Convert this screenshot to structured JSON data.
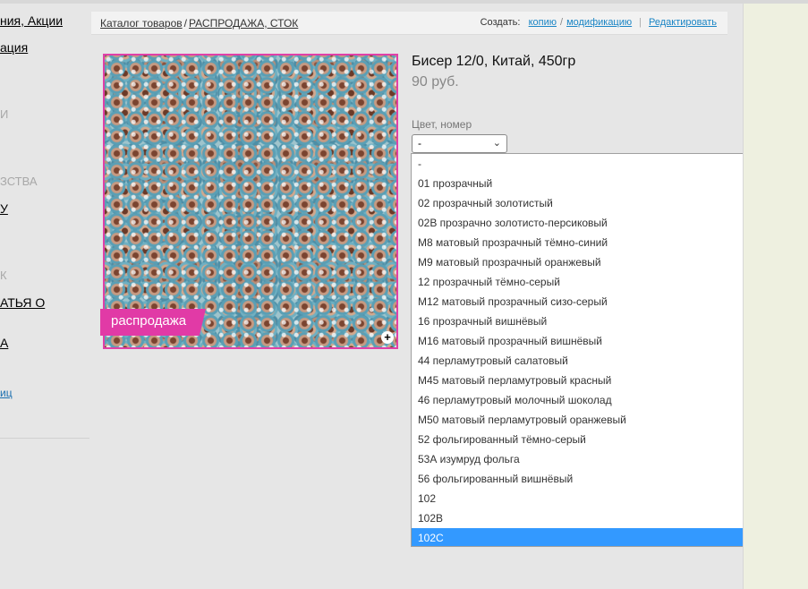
{
  "sidebar": {
    "items": [
      {
        "label": "ния, Акции",
        "style": "link"
      },
      {
        "label": "ация",
        "style": "link"
      },
      {
        "label": "И",
        "style": "grey"
      },
      {
        "label": "ЗСТВА",
        "style": "grey"
      },
      {
        "label": "У",
        "style": "link"
      },
      {
        "label": "К",
        "style": "grey"
      },
      {
        "label": "АТЬЯ О",
        "style": "link"
      },
      {
        "label": "А",
        "style": "link"
      },
      {
        "label": "иц",
        "style": "blue"
      }
    ]
  },
  "breadcrumb": {
    "items": [
      {
        "label": "Каталог товаров"
      },
      {
        "label": "РАСПРОДАЖА, СТОК"
      }
    ],
    "separator": "/"
  },
  "actions": {
    "create_label": "Создать:",
    "copy_label": "копию",
    "slash": "/",
    "modification_label": "модификацию",
    "divider": "|",
    "edit_label": "Редактировать"
  },
  "product": {
    "title": "Бисер 12/0, Китай, 450гр",
    "price": "90 руб.",
    "badge": "распродажа",
    "zoom_icon": "+"
  },
  "option_select": {
    "label": "Цвет, номер",
    "value": "-",
    "arrow": "⌄"
  },
  "dropdown": {
    "options": [
      "-",
      "01 прозрачный",
      "02 прозрачный золотистый",
      "02В прозрачно золотисто-персиковый",
      "М8 матовый прозрачный тёмно-синий",
      "М9 матовый прозрачный оранжевый",
      "12 прозрачный тёмно-серый",
      "М12 матовый прозрачный сизо-серый",
      "16 прозрачный вишнёвый",
      "М16 матовый прозрачный вишнёвый",
      "44 перламутровый салатовый",
      "М45 матовый перламутровый красный",
      "46 перламутровый молочный шоколад",
      "М50 матовый перламутровый оранжевый",
      "52 фольгированный тёмно-серый",
      "53А изумруд фольга",
      "56 фольгированный вишнёвый",
      "102",
      "102В",
      "102С"
    ],
    "selected_index": 19,
    "scroll_up": "▲",
    "scroll_down": "▼"
  },
  "colors": {
    "accent": "#e040a8",
    "link": "#1a85c5",
    "selected": "#3399ff"
  }
}
